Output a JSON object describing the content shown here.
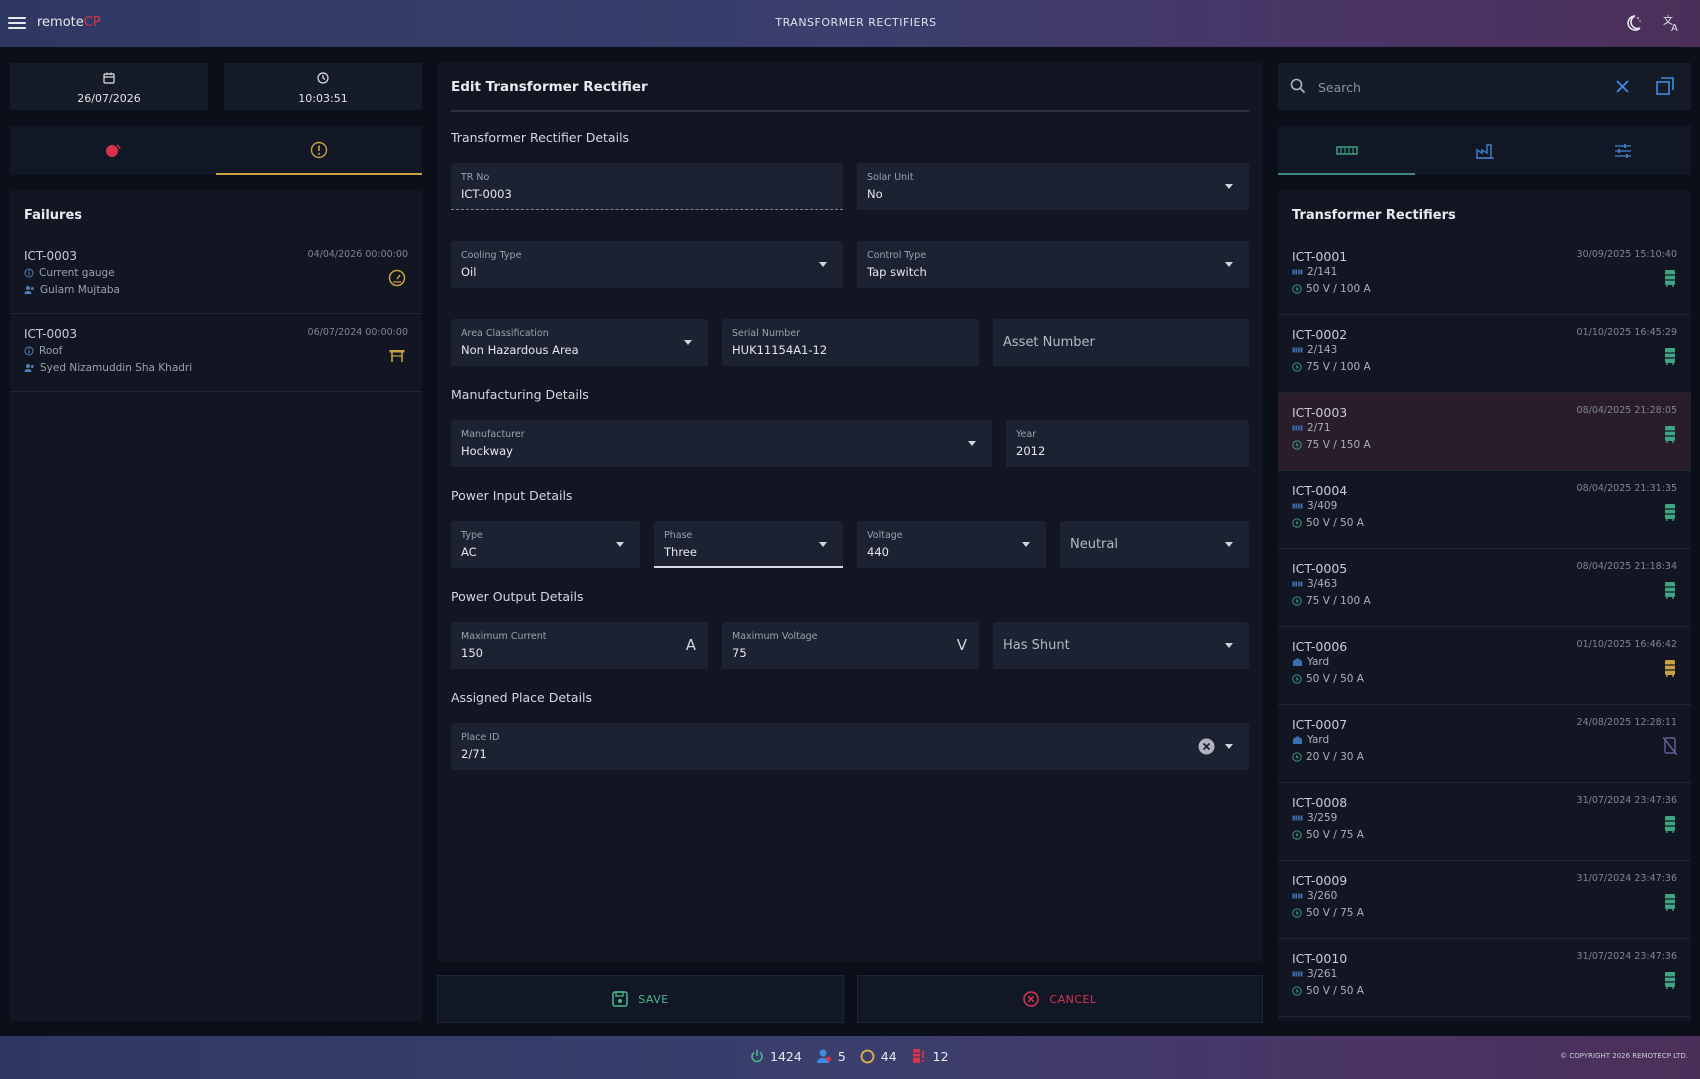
{
  "app": {
    "brand_prefix": "remote",
    "brand_suffix": "CP",
    "title": "TRANSFORMER RECTIFIERS"
  },
  "left": {
    "date": "26/07/2026",
    "time": "10:03:51",
    "failures_title": "Failures",
    "failures": [
      {
        "id": "ICT-0003",
        "date": "04/04/2026 00:00:00",
        "reason": "Current gauge",
        "person": "Gulam Mujtaba",
        "icon": "gauge-icon"
      },
      {
        "id": "ICT-0003",
        "date": "06/07/2024 00:00:00",
        "reason": "Roof",
        "person": "Syed Nizamuddin Sha Khadri",
        "icon": "roof-icon"
      }
    ]
  },
  "form": {
    "title": "Edit Transformer Rectifier",
    "sections": {
      "tr_details": "Transformer Rectifier Details",
      "manufacturing": "Manufacturing Details",
      "power_input": "Power Input Details",
      "power_output": "Power Output Details",
      "assigned_place": "Assigned Place Details"
    },
    "tr_no": {
      "label": "TR No",
      "value": "ICT-0003"
    },
    "solar_unit": {
      "label": "Solar Unit",
      "value": "No"
    },
    "cooling_type": {
      "label": "Cooling Type",
      "value": "Oil"
    },
    "control_type": {
      "label": "Control Type",
      "value": "Tap switch"
    },
    "area_classification": {
      "label": "Area Classification",
      "value": "Non Hazardous Area"
    },
    "serial_number": {
      "label": "Serial Number",
      "value": "HUK11154A1-12"
    },
    "asset_number": {
      "placeholder": "Asset Number"
    },
    "manufacturer": {
      "label": "Manufacturer",
      "value": "Hockway"
    },
    "year": {
      "label": "Year",
      "value": "2012"
    },
    "type": {
      "label": "Type",
      "value": "AC"
    },
    "phase": {
      "label": "Phase",
      "value": "Three"
    },
    "voltage": {
      "label": "Voltage",
      "value": "440"
    },
    "neutral": {
      "placeholder": "Neutral"
    },
    "max_current": {
      "label": "Maximum Current",
      "value": "150",
      "unit": "A"
    },
    "max_voltage": {
      "label": "Maximum Voltage",
      "value": "75",
      "unit": "V"
    },
    "has_shunt": {
      "placeholder": "Has Shunt"
    },
    "place_id": {
      "label": "Place ID",
      "value": "2/71"
    },
    "save_label": "SAVE",
    "cancel_label": "CANCEL"
  },
  "right": {
    "search_placeholder": "Search",
    "list_title": "Transformer Rectifiers",
    "items": [
      {
        "id": "ICT-0001",
        "date": "30/09/2025 15:10:40",
        "place": "2/141",
        "rating": "50 V / 100 A",
        "status": "ok",
        "selected": false
      },
      {
        "id": "ICT-0002",
        "date": "01/10/2025 16:45:29",
        "place": "2/143",
        "rating": "75 V / 100 A",
        "status": "ok",
        "selected": false
      },
      {
        "id": "ICT-0003",
        "date": "08/04/2025 21:28:05",
        "place": "2/71",
        "rating": "75 V / 150 A",
        "status": "ok",
        "selected": true
      },
      {
        "id": "ICT-0004",
        "date": "08/04/2025 21:31:35",
        "place": "3/409",
        "rating": "50 V / 50 A",
        "status": "ok",
        "selected": false
      },
      {
        "id": "ICT-0005",
        "date": "08/04/2025 21:18:34",
        "place": "3/463",
        "rating": "75 V / 100 A",
        "status": "ok",
        "selected": false
      },
      {
        "id": "ICT-0006",
        "date": "01/10/2025 16:46:42",
        "place": "Yard",
        "rating": "50 V / 50 A",
        "status": "warn",
        "selected": false
      },
      {
        "id": "ICT-0007",
        "date": "24/08/2025 12:28:11",
        "place": "Yard",
        "rating": "20 V / 30 A",
        "status": "off",
        "selected": false
      },
      {
        "id": "ICT-0008",
        "date": "31/07/2024 23:47:36",
        "place": "3/259",
        "rating": "50 V / 75 A",
        "status": "ok",
        "selected": false
      },
      {
        "id": "ICT-0009",
        "date": "31/07/2024 23:47:36",
        "place": "3/260",
        "rating": "50 V / 75 A",
        "status": "ok",
        "selected": false
      },
      {
        "id": "ICT-0010",
        "date": "31/07/2024 23:47:36",
        "place": "3/261",
        "rating": "50 V / 50 A",
        "status": "ok",
        "selected": false
      }
    ]
  },
  "footer": {
    "power_count": "1424",
    "user_count": "5",
    "circle_count": "44",
    "alert_count": "12",
    "copyright": "© COPYRIGHT 2026 REMOTECP LTD."
  },
  "colors": {
    "ok": "#3fa583",
    "warn": "#c9a23f",
    "off": "#6a5a9a",
    "accent_red": "#d8334c",
    "save": "#4bb88a",
    "cancel": "#d8334c"
  }
}
